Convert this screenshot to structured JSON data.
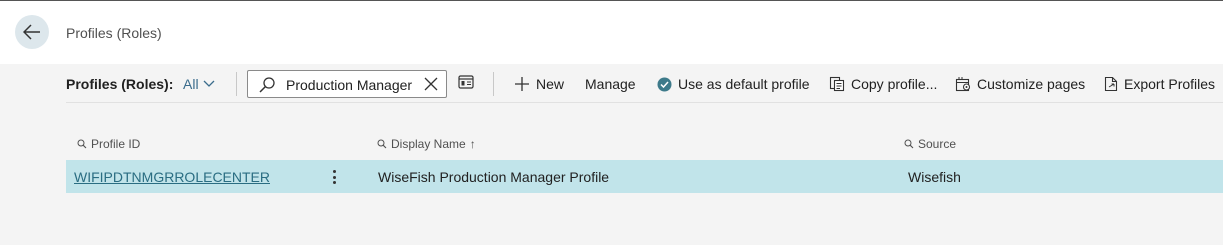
{
  "header": {
    "title": "Profiles (Roles)"
  },
  "actionbar": {
    "caption": "Profiles (Roles):",
    "filter_all": "All",
    "search_value": "Production Manager",
    "new_label": "New",
    "manage_label": "Manage",
    "default_label": "Use as default profile",
    "copy_label": "Copy profile...",
    "customize_label": "Customize pages",
    "export_label": "Export Profiles"
  },
  "table": {
    "columns": [
      "Profile ID",
      "Display Name",
      "Source"
    ],
    "sort_indicator": "↑",
    "rows": [
      {
        "profile_id": "WIFIPDTNMGRROLECENTER",
        "display_name": "WiseFish Production Manager Profile",
        "source": "Wisefish"
      }
    ]
  },
  "colors": {
    "accent": "#3a6c8c",
    "selected_row": "#c1e4ea",
    "link": "#2a6d82",
    "check": "#3d7a8a"
  }
}
